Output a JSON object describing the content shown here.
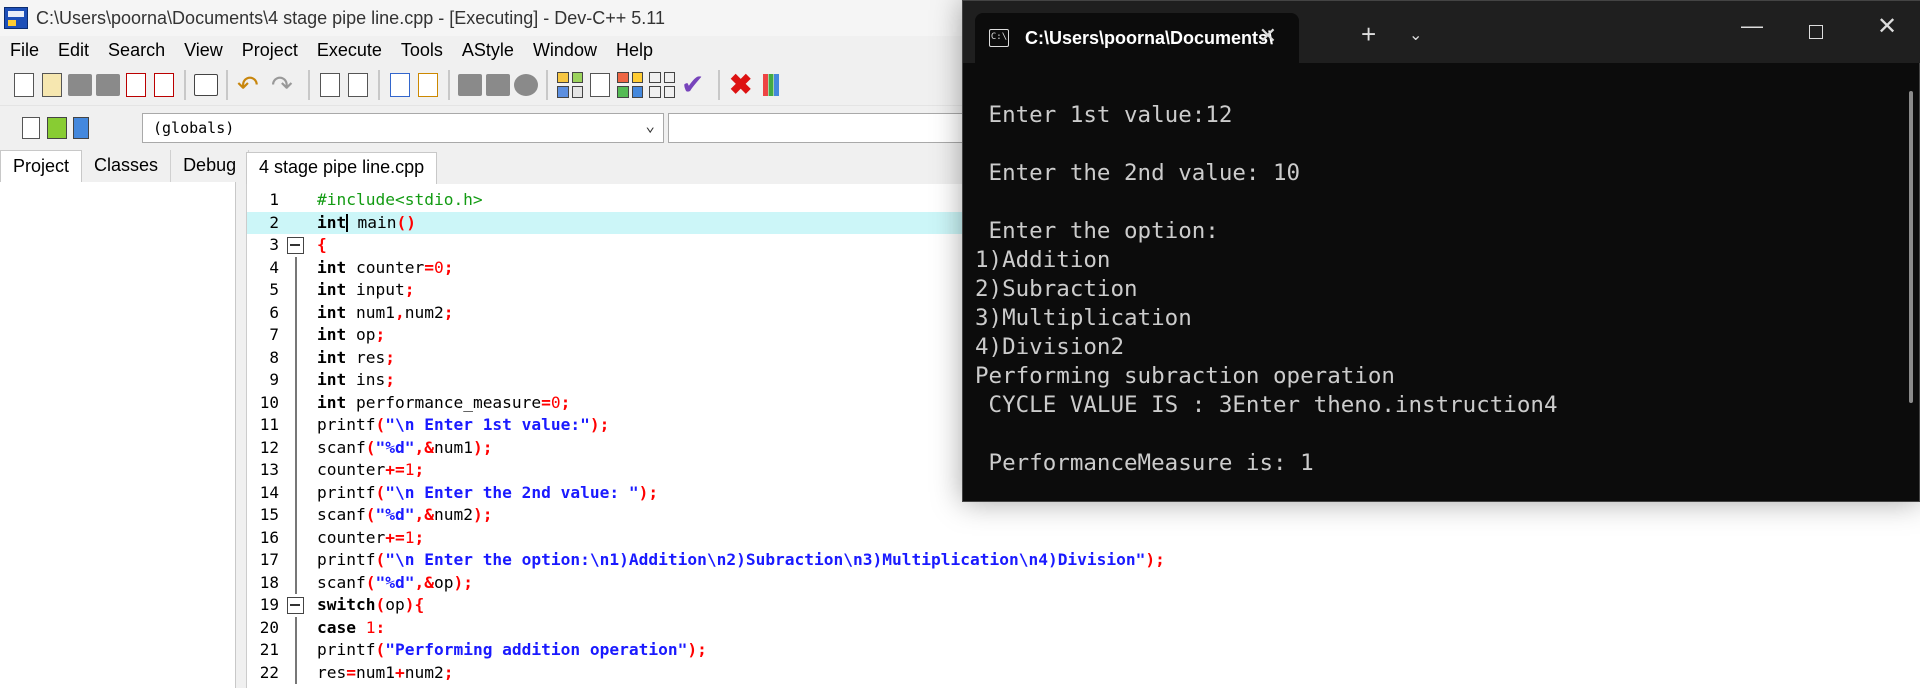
{
  "ide": {
    "title": "C:\\Users\\poorna\\Documents\\4 stage pipe line.cpp - [Executing] - Dev-C++ 5.11",
    "menu": [
      "File",
      "Edit",
      "Search",
      "View",
      "Project",
      "Execute",
      "Tools",
      "AStyle",
      "Window",
      "Help"
    ],
    "scope": "(globals)",
    "panel_tabs": [
      "Project",
      "Classes",
      "Debug"
    ],
    "editor_tab": "4 stage pipe line.cpp",
    "code": [
      {
        "n": "1",
        "segs": [
          [
            "pp",
            "#include<stdio.h>"
          ]
        ]
      },
      {
        "n": "2",
        "current": true,
        "segs": [
          [
            "kw",
            "int"
          ],
          [
            "cursor",
            ""
          ],
          [
            "plain",
            " main"
          ],
          [
            "sym",
            "()"
          ]
        ]
      },
      {
        "n": "3",
        "fold": "box",
        "segs": [
          [
            "sym",
            "{"
          ]
        ]
      },
      {
        "n": "4",
        "fold": "line",
        "segs": [
          [
            "kw",
            "int"
          ],
          [
            "plain",
            " counter"
          ],
          [
            "sym",
            "="
          ],
          [
            "num",
            "0"
          ],
          [
            "sym",
            ";"
          ]
        ]
      },
      {
        "n": "5",
        "fold": "line",
        "segs": [
          [
            "kw",
            "int"
          ],
          [
            "plain",
            " input"
          ],
          [
            "sym",
            ";"
          ]
        ]
      },
      {
        "n": "6",
        "fold": "line",
        "segs": [
          [
            "kw",
            "int"
          ],
          [
            "plain",
            " num1"
          ],
          [
            "sym",
            ","
          ],
          [
            "plain",
            "num2"
          ],
          [
            "sym",
            ";"
          ]
        ]
      },
      {
        "n": "7",
        "fold": "line",
        "segs": [
          [
            "kw",
            "int"
          ],
          [
            "plain",
            " op"
          ],
          [
            "sym",
            ";"
          ]
        ]
      },
      {
        "n": "8",
        "fold": "line",
        "segs": [
          [
            "kw",
            "int"
          ],
          [
            "plain",
            " res"
          ],
          [
            "sym",
            ";"
          ]
        ]
      },
      {
        "n": "9",
        "fold": "line",
        "segs": [
          [
            "kw",
            "int"
          ],
          [
            "plain",
            " ins"
          ],
          [
            "sym",
            ";"
          ]
        ]
      },
      {
        "n": "10",
        "fold": "line",
        "segs": [
          [
            "kw",
            "int"
          ],
          [
            "plain",
            " performance_measure"
          ],
          [
            "sym",
            "="
          ],
          [
            "num",
            "0"
          ],
          [
            "sym",
            ";"
          ]
        ]
      },
      {
        "n": "11",
        "fold": "line",
        "segs": [
          [
            "plain",
            "printf"
          ],
          [
            "sym",
            "("
          ],
          [
            "str",
            "\"\\n Enter 1st value:\""
          ],
          [
            "sym",
            ");"
          ]
        ]
      },
      {
        "n": "12",
        "fold": "line",
        "segs": [
          [
            "plain",
            "scanf"
          ],
          [
            "sym",
            "("
          ],
          [
            "str",
            "\"%d\""
          ],
          [
            "sym",
            ",&"
          ],
          [
            "plain",
            "num1"
          ],
          [
            "sym",
            ");"
          ]
        ]
      },
      {
        "n": "13",
        "fold": "line",
        "segs": [
          [
            "plain",
            "counter"
          ],
          [
            "sym",
            "+="
          ],
          [
            "num",
            "1"
          ],
          [
            "sym",
            ";"
          ]
        ]
      },
      {
        "n": "14",
        "fold": "line",
        "segs": [
          [
            "plain",
            "printf"
          ],
          [
            "sym",
            "("
          ],
          [
            "str",
            "\"\\n Enter the 2nd value: \""
          ],
          [
            "sym",
            ");"
          ]
        ]
      },
      {
        "n": "15",
        "fold": "line",
        "segs": [
          [
            "plain",
            "scanf"
          ],
          [
            "sym",
            "("
          ],
          [
            "str",
            "\"%d\""
          ],
          [
            "sym",
            ",&"
          ],
          [
            "plain",
            "num2"
          ],
          [
            "sym",
            ");"
          ]
        ]
      },
      {
        "n": "16",
        "fold": "line",
        "segs": [
          [
            "plain",
            "counter"
          ],
          [
            "sym",
            "+="
          ],
          [
            "num",
            "1"
          ],
          [
            "sym",
            ";"
          ]
        ]
      },
      {
        "n": "17",
        "fold": "line",
        "segs": [
          [
            "plain",
            "printf"
          ],
          [
            "sym",
            "("
          ],
          [
            "str",
            "\"\\n Enter the option:\\n1)Addition\\n2)Subraction\\n3)Multiplication\\n4)Division\""
          ],
          [
            "sym",
            ");"
          ]
        ]
      },
      {
        "n": "18",
        "fold": "line",
        "segs": [
          [
            "plain",
            "scanf"
          ],
          [
            "sym",
            "("
          ],
          [
            "str",
            "\"%d\""
          ],
          [
            "sym",
            ",&"
          ],
          [
            "plain",
            "op"
          ],
          [
            "sym",
            ");"
          ]
        ]
      },
      {
        "n": "19",
        "fold": "box",
        "segs": [
          [
            "kw",
            "switch"
          ],
          [
            "sym",
            "("
          ],
          [
            "plain",
            "op"
          ],
          [
            "sym",
            "){"
          ]
        ]
      },
      {
        "n": "20",
        "fold": "line",
        "segs": [
          [
            "kw",
            "case"
          ],
          [
            "plain",
            " "
          ],
          [
            "num",
            "1"
          ],
          [
            "sym",
            ":"
          ]
        ]
      },
      {
        "n": "21",
        "fold": "line",
        "segs": [
          [
            "plain",
            "printf"
          ],
          [
            "sym",
            "("
          ],
          [
            "str",
            "\"Performing addition operation\""
          ],
          [
            "sym",
            ");"
          ]
        ]
      },
      {
        "n": "22",
        "fold": "line",
        "segs": [
          [
            "plain",
            "res"
          ],
          [
            "sym",
            "="
          ],
          [
            "plain",
            "num1"
          ],
          [
            "sym",
            "+"
          ],
          [
            "plain",
            "num2"
          ],
          [
            "sym",
            ";"
          ]
        ]
      }
    ]
  },
  "console": {
    "tab_title": "C:\\Users\\poorna\\Documents\\",
    "tab_icon_text": "C:\\",
    "lines": [
      " Enter 1st value:12",
      "",
      " Enter the 2nd value: 10",
      "",
      " Enter the option:",
      "1)Addition",
      "2)Subraction",
      "3)Multiplication",
      "4)Division2",
      "Performing subraction operation",
      " CYCLE VALUE IS : 3Enter theno.instruction4",
      "",
      " PerformanceMeasure is: 1"
    ]
  },
  "colors": {
    "current_line": "#ccf6f8",
    "preprocessor": "#139b13",
    "string": "#1a1aff",
    "number_symbol": "#ff0000",
    "console_bg": "#0c0c0c",
    "console_text": "#cccccc"
  }
}
